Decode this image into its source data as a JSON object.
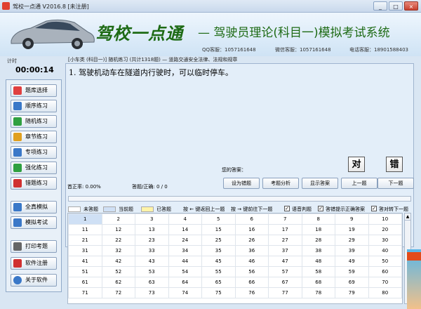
{
  "window": {
    "title": "驾校一点通 V2016.8 [未注册]",
    "buttons": [
      "_",
      "□",
      "×"
    ]
  },
  "header": {
    "brand": "驾校一点通",
    "subtitle": "— 驾驶员理论(科目一)模拟考试系统",
    "qq": "QQ客服：1057161648",
    "wechat": "微信客服：1057161648",
    "phone": "电话客服：18901588403"
  },
  "timer": {
    "label": "计时",
    "value": "00:00:14"
  },
  "sidebar": {
    "items": [
      {
        "label": "题库选择",
        "icon": "database-icon",
        "color": "#e04040"
      },
      {
        "label": "顺序练习",
        "icon": "checklist-icon",
        "color": "#3a78c8"
      },
      {
        "label": "随机练习",
        "icon": "shuffle-icon",
        "color": "#2fa040"
      },
      {
        "label": "章节练习",
        "icon": "chapter-icon",
        "color": "#e0a020"
      },
      {
        "label": "专项练习",
        "icon": "checkbox-icon",
        "color": "#3a78c8"
      },
      {
        "label": "强化练习",
        "icon": "strengthen-icon",
        "color": "#2fa040"
      },
      {
        "label": "错题练习",
        "icon": "flag-icon",
        "color": "#d03030"
      },
      {
        "label": "全真模拟",
        "icon": "grid-icon",
        "color": "#3a78c8"
      },
      {
        "label": "模拟考试",
        "icon": "exam-icon",
        "color": "#3a78c8"
      },
      {
        "label": "打印考题",
        "icon": "print-icon",
        "color": "#666666"
      },
      {
        "label": "软件注册",
        "icon": "register-icon",
        "color": "#d03030"
      },
      {
        "label": "关于软件",
        "icon": "info-icon",
        "color": "#3a78c8"
      }
    ]
  },
  "breadcrumb": "[小车类 (科目一)] 随机练习 (共计1318题) — 道路交通安全法律、法规和规章",
  "question": {
    "text": "1. 驾驶机动车在隧道内行驶时，可以临时停车。"
  },
  "answers": {
    "correct": "对",
    "wrong": "错",
    "your_answer_label": "您的答案："
  },
  "stats": {
    "accuracy": "首正率: 0.00%",
    "answered": "答题/正确: 0 / 0"
  },
  "actions": [
    "设为错题",
    "考题分析",
    "显示答案",
    "上一题",
    "下一题"
  ],
  "legend": {
    "unanswered": "未答题",
    "current": "当前题",
    "answered": "已答题",
    "prev_hint": "按 ← 键返回上一题",
    "next_hint": "按 → 键前往下一题",
    "voice": "语音判题",
    "show_correct": "答错提示正确答案",
    "auto_next": "答对转下一题"
  },
  "grid": {
    "rows": [
      [
        "1",
        "2",
        "3",
        "4",
        "5",
        "6",
        "7",
        "8",
        "9",
        "10"
      ],
      [
        "11",
        "12",
        "13",
        "14",
        "15",
        "16",
        "17",
        "18",
        "19",
        "20"
      ],
      [
        "21",
        "22",
        "23",
        "24",
        "25",
        "26",
        "27",
        "28",
        "29",
        "30"
      ],
      [
        "31",
        "32",
        "33",
        "34",
        "35",
        "36",
        "37",
        "38",
        "39",
        "40"
      ],
      [
        "41",
        "42",
        "43",
        "44",
        "45",
        "46",
        "47",
        "48",
        "49",
        "50"
      ],
      [
        "51",
        "52",
        "53",
        "54",
        "55",
        "56",
        "57",
        "58",
        "59",
        "60"
      ],
      [
        "61",
        "62",
        "63",
        "64",
        "65",
        "66",
        "67",
        "68",
        "69",
        "70"
      ],
      [
        "71",
        "72",
        "73",
        "74",
        "75",
        "76",
        "77",
        "78",
        "79",
        "80"
      ]
    ]
  },
  "colors": {
    "brand": "#1d6a14",
    "current": "#cfe0f5",
    "answered": "#fff3a8"
  }
}
